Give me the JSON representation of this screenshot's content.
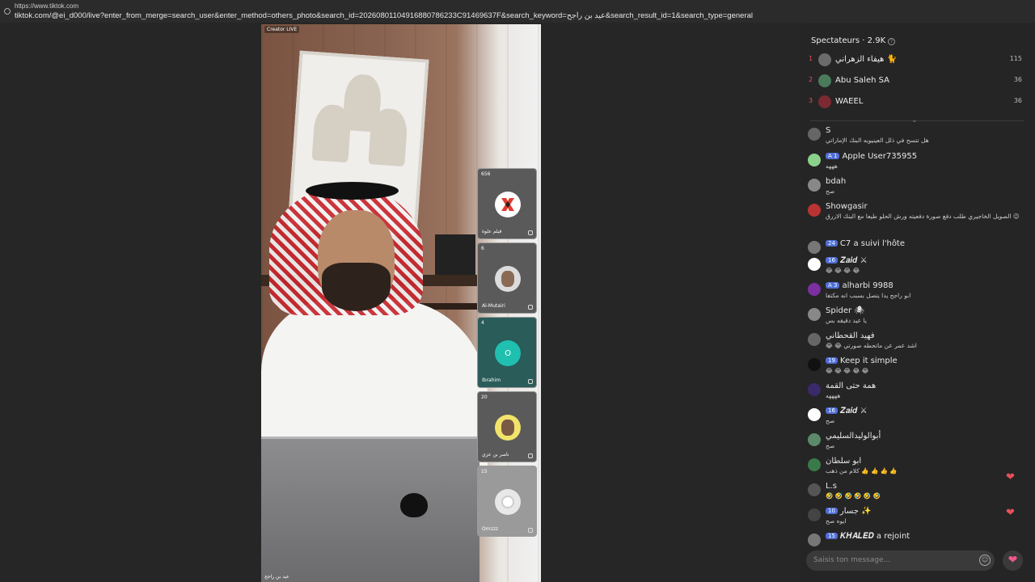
{
  "browser": {
    "site": "https://www.tiktok.com",
    "url": "tiktok.com/@ei_d000/live?enter_from_merge=search_user&enter_method=others_photo&search_id=20260801104916880786233C91469637F&search_keyword=عيد بن راجح&search_result_id=1&search_type=general"
  },
  "stream": {
    "badge": "Creator LIVE",
    "caption": "عيد بن راجح",
    "guests": [
      {
        "count": "656",
        "name": "فيلم علوة",
        "avatar_bg": "#ffffff",
        "avatar_text": ""
      },
      {
        "count": "6",
        "name": "Al-Mutairi",
        "avatar_bg": "#dcdcdc",
        "avatar_text": ""
      },
      {
        "count": "4",
        "name": "Ibrahim",
        "avatar_bg": "#20c0b0",
        "avatar_text": "O"
      },
      {
        "count": "20",
        "name": "ناصر بن عزي",
        "avatar_bg": "#f2e36b",
        "avatar_text": ""
      },
      {
        "count": "15",
        "name": "Omzzz",
        "avatar_bg": "#e8e8e8",
        "avatar_text": ""
      }
    ]
  },
  "spectators": {
    "title": "Spectateurs · 2.9K",
    "top": [
      {
        "rank": "1",
        "name": "هيفاء الزهراني 🐈",
        "score": "115"
      },
      {
        "rank": "2",
        "name": "Abu Saleh SA",
        "score": "36"
      },
      {
        "rank": "3",
        "name": "WAEEL",
        "score": "36"
      }
    ]
  },
  "chat": [
    {
      "user": "S",
      "level": "",
      "text": "هل تتسح في ذلل العينيوبه البنك الإماراتي"
    },
    {
      "user": "Apple User735955",
      "level": "A 1",
      "text": "هههه"
    },
    {
      "user": "bdah",
      "level": "",
      "text": "صح"
    },
    {
      "user": "Showgasir",
      "level": "",
      "text": "الصويل الخاجيري طلب دفع صورة دفعيته ورش الحلو طيعا مع البنك الازرق 😉"
    },
    {
      "user": "C7  a suivi l'hôte",
      "level": "24",
      "text": ""
    },
    {
      "user": "𝒁𝒂𝒊𝒅 ⚔",
      "level": "16",
      "text": "😂 😂 😂 😂"
    },
    {
      "user": "alharbi 9988",
      "level": "A 3",
      "text": "ابو راجح يدا يتصل بسبب انه مكتفا"
    },
    {
      "user": "Spider 🕷",
      "level": "",
      "text": "يا عيد دقيقه بس"
    },
    {
      "user": "فهيد القحطاني",
      "level": "",
      "text": "😂 😂 اشد عمر عن ماتحطه صورتي"
    },
    {
      "user": "Keep it simple",
      "level": "19",
      "text": "😂 😂 😂 😂 😂"
    },
    {
      "user": "همة حتى القمة",
      "level": "",
      "text": "ههههه"
    },
    {
      "user": "𝒁𝒂𝒊𝒅 ⚔",
      "level": "16",
      "text": "صح"
    },
    {
      "user": "أبوالوليدالسليمي",
      "level": "",
      "text": "صح"
    },
    {
      "user": "ابو سلطان",
      "level": "",
      "text": "كلام من ذهب 👍 👍 👍 👍"
    },
    {
      "user": "L.s",
      "level": "",
      "text": "🤣 🤣 🤣 🤣 🤣 🤣"
    },
    {
      "user": "جسار ✨",
      "level": "10",
      "text": "ايوه صح"
    },
    {
      "user": "𝑲𝑯𝑨𝑳𝑬𝑫  a rejoint",
      "level": "15",
      "text": ""
    }
  ],
  "input": {
    "placeholder": "Saisis ton message..."
  },
  "colors": {
    "accent": "#e7505b",
    "level_badge": "#4f6fd8",
    "like": "#f05a89"
  }
}
